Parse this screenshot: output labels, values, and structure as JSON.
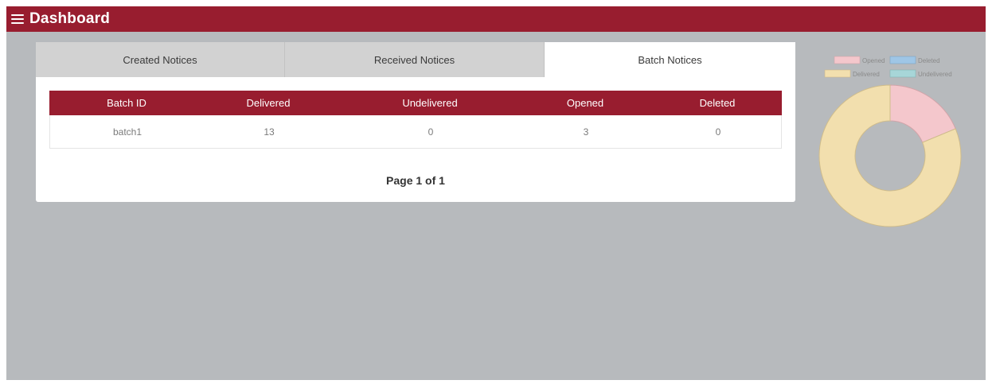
{
  "header": {
    "title": "Dashboard",
    "menu_icon": "hamburger-menu-icon"
  },
  "tabs": [
    {
      "label": "Created Notices",
      "active": false
    },
    {
      "label": "Received Notices",
      "active": false
    },
    {
      "label": "Batch Notices",
      "active": true
    }
  ],
  "table": {
    "columns": [
      "Batch ID",
      "Delivered",
      "Undelivered",
      "Opened",
      "Deleted"
    ],
    "rows": [
      [
        "batch1",
        "13",
        "0",
        "3",
        "0"
      ]
    ]
  },
  "pagination": {
    "text": "Page 1 of 1"
  },
  "colors": {
    "brand": "#981d2f",
    "background": "#b7babd"
  },
  "chart_data": {
    "type": "pie",
    "legend": [
      "Opened",
      "Deleted",
      "Delivered",
      "Undelivered"
    ],
    "legend_placement": "top",
    "categories": [
      "Opened",
      "Delivered",
      "Undelivered",
      "Deleted"
    ],
    "values": [
      3,
      13,
      0,
      0
    ],
    "colors": {
      "Opened": "#f4c7cc",
      "Deleted": "#9fc6e6",
      "Delivered": "#f2dfae",
      "Undelivered": "#a7d6d8"
    },
    "donut": true
  }
}
